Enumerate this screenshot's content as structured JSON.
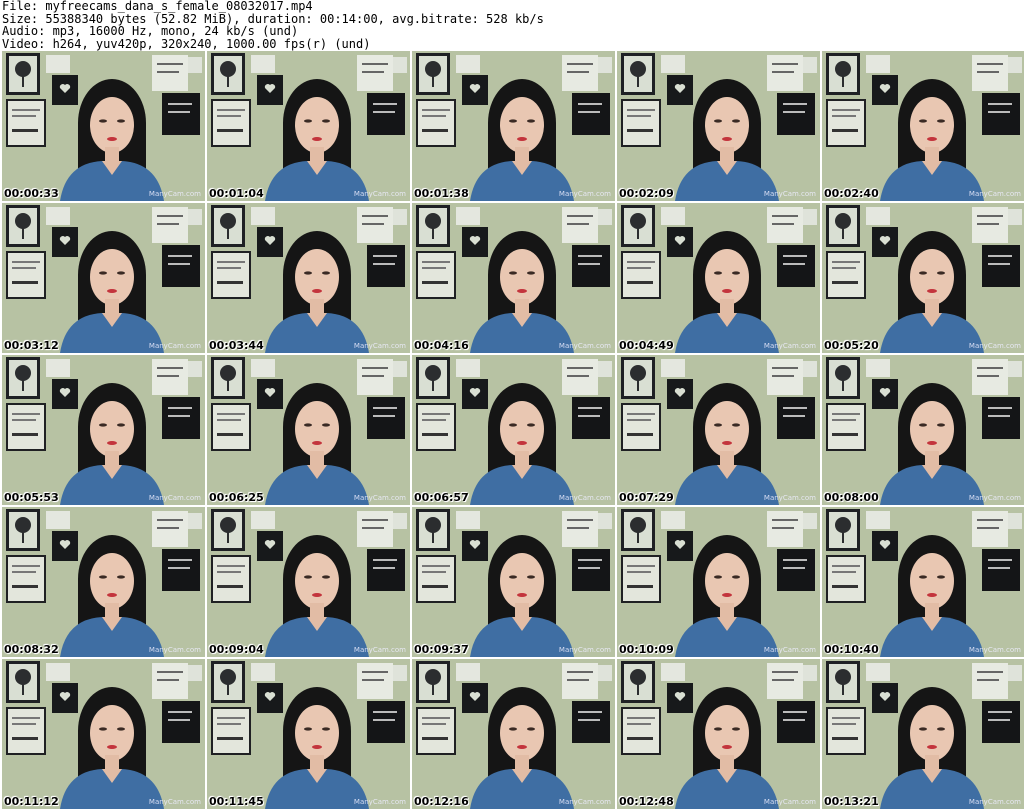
{
  "header": {
    "file": "File: myfreecams_dana_s_female_08032017.mp4",
    "size": "Size: 55388340 bytes (52.82 MiB), duration: 00:14:00, avg.bitrate: 528 kb/s",
    "audio": "Audio: mp3, 16000 Hz, mono, 24 kb/s (und)",
    "video": "Video: h264, yuv420p, 320x240, 1000.00 fps(r) (und)"
  },
  "watermark": "ManyCam.com",
  "thumbnails": [
    {
      "timestamp": "00:00:33"
    },
    {
      "timestamp": "00:01:04"
    },
    {
      "timestamp": "00:01:38"
    },
    {
      "timestamp": "00:02:09"
    },
    {
      "timestamp": "00:02:40"
    },
    {
      "timestamp": "00:03:12"
    },
    {
      "timestamp": "00:03:44"
    },
    {
      "timestamp": "00:04:16"
    },
    {
      "timestamp": "00:04:49"
    },
    {
      "timestamp": "00:05:20"
    },
    {
      "timestamp": "00:05:53"
    },
    {
      "timestamp": "00:06:25"
    },
    {
      "timestamp": "00:06:57"
    },
    {
      "timestamp": "00:07:29"
    },
    {
      "timestamp": "00:08:00"
    },
    {
      "timestamp": "00:08:32"
    },
    {
      "timestamp": "00:09:04"
    },
    {
      "timestamp": "00:09:37"
    },
    {
      "timestamp": "00:10:09"
    },
    {
      "timestamp": "00:10:40"
    },
    {
      "timestamp": "00:11:12"
    },
    {
      "timestamp": "00:11:45"
    },
    {
      "timestamp": "00:12:16"
    },
    {
      "timestamp": "00:12:48"
    },
    {
      "timestamp": "00:13:21"
    }
  ]
}
